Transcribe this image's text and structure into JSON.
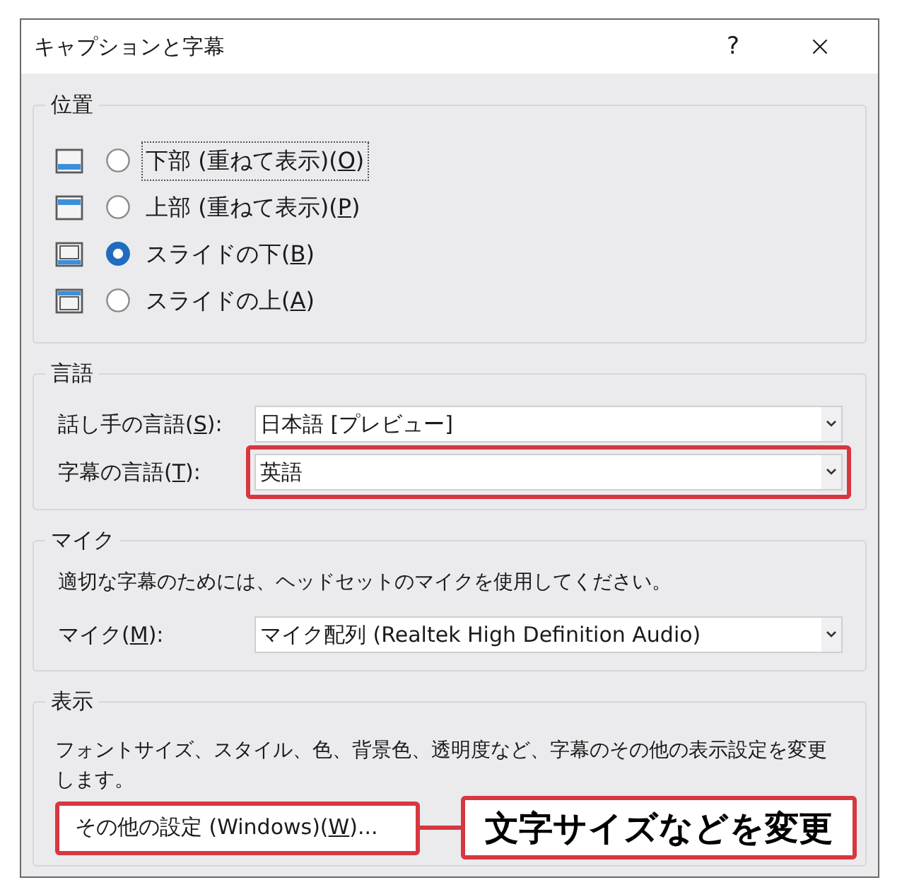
{
  "window": {
    "title": "キャプションと字幕",
    "help_button": "?"
  },
  "position": {
    "heading": "位置",
    "options": [
      {
        "kind": "overlay_bottom",
        "label": "下部 (重ねて表示)(",
        "access_key": "O",
        "label_end": ")",
        "selected": false,
        "focused": true
      },
      {
        "kind": "overlay_top",
        "label": "上部 (重ねて表示)(",
        "access_key": "P",
        "label_end": ")",
        "selected": false,
        "focused": false
      },
      {
        "kind": "below",
        "label": "スライドの下(",
        "access_key": "B",
        "label_end": ")",
        "selected": true,
        "focused": false
      },
      {
        "kind": "above",
        "label": "スライドの上(",
        "access_key": "A",
        "label_end": ")",
        "selected": false,
        "focused": false
      }
    ]
  },
  "language": {
    "heading": "言語",
    "rows": [
      {
        "label": "話し手の言語(",
        "access_key": "S",
        "label_end": "):",
        "value": "日本語 [プレビュー]",
        "highlighted": false
      },
      {
        "label": "字幕の言語(",
        "access_key": "T",
        "label_end": "):",
        "value": "英語",
        "highlighted": true
      }
    ]
  },
  "microphone": {
    "heading": "マイク",
    "description": "適切な字幕のためには、ヘッドセットのマイクを使用してください。",
    "row": {
      "label": "マイク(",
      "access_key": "M",
      "label_end": "):",
      "value": "マイク配列 (Realtek High Definition Audio)"
    }
  },
  "display": {
    "heading": "表示",
    "description": "フォントサイズ、スタイル、色、背景色、透明度など、字幕のその他の表示設定を変更します。",
    "button": {
      "label": "その他の設定 (Windows)(",
      "access_key": "W",
      "label_end": ")...",
      "highlighted": true
    }
  },
  "callout": {
    "text": "文字サイズなどを変更"
  }
}
